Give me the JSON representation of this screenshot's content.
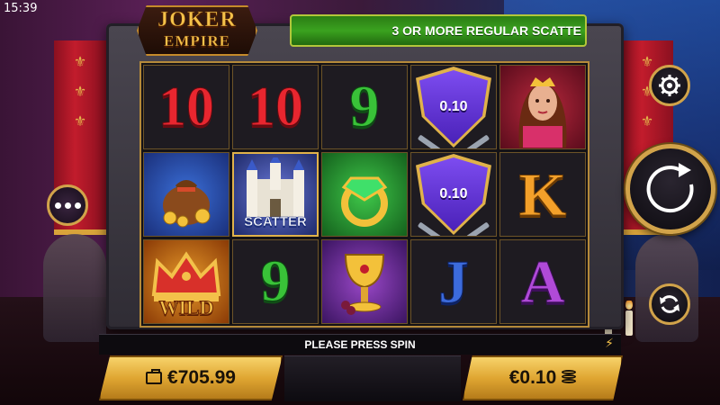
{
  "status_bar": {
    "time": "15:39"
  },
  "logo": {
    "line1": "JOKER",
    "line2": "EMPIRE"
  },
  "ticker": {
    "text": "3 OR MORE REGULAR SCATTE"
  },
  "reels": {
    "columns": [
      [
        {
          "symbol": "10",
          "kind": "num10"
        },
        {
          "symbol": "money-bag",
          "kind": "image"
        },
        {
          "symbol": "crown-wild",
          "kind": "wild",
          "label": "WILD"
        }
      ],
      [
        {
          "symbol": "10",
          "kind": "num10"
        },
        {
          "symbol": "castle-scatter",
          "kind": "scatter",
          "label": "SCATTER"
        },
        {
          "symbol": "9",
          "kind": "num9"
        }
      ],
      [
        {
          "symbol": "9",
          "kind": "num9"
        },
        {
          "symbol": "emerald-ring",
          "kind": "image"
        },
        {
          "symbol": "golden-chalice",
          "kind": "image"
        }
      ],
      [
        {
          "symbol": "coin-shield",
          "kind": "shield",
          "value": "0.10"
        },
        {
          "symbol": "coin-shield",
          "kind": "shield",
          "value": "0.10"
        },
        {
          "symbol": "J",
          "kind": "letJ"
        }
      ],
      [
        {
          "symbol": "princess",
          "kind": "image"
        },
        {
          "symbol": "K",
          "kind": "letK"
        },
        {
          "symbol": "A",
          "kind": "letA"
        }
      ]
    ]
  },
  "message_bar": {
    "text": "PLEASE PRESS SPIN"
  },
  "balance": {
    "value": "€705.99",
    "icon": "wallet-icon"
  },
  "bet": {
    "value": "€0.10",
    "icon": "coins-icon"
  },
  "controls": {
    "settings_icon": "gear-icon",
    "spin_icon": "spin-arrow-icon",
    "autoplay_icon": "autoplay-icon",
    "menu_icon": "more-dots-icon",
    "turbo_icon": "lightning-icon"
  },
  "colors": {
    "gold": "#d1a34a",
    "ticker_green": "#3aa21f",
    "shield_purple": "#6a3ae0"
  }
}
